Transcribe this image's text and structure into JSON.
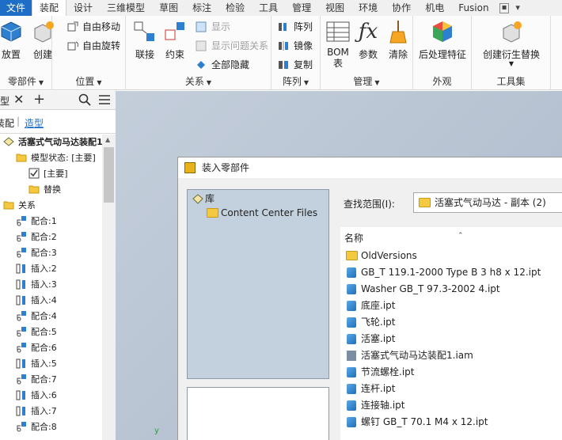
{
  "tabs": [
    {
      "label": "文件",
      "kind": "file"
    },
    {
      "label": "装配",
      "kind": "active"
    },
    {
      "label": "设计"
    },
    {
      "label": "三维模型"
    },
    {
      "label": "草图"
    },
    {
      "label": "标注"
    },
    {
      "label": "检验"
    },
    {
      "label": "工具"
    },
    {
      "label": "管理"
    },
    {
      "label": "视图"
    },
    {
      "label": "环境"
    },
    {
      "label": "协作"
    },
    {
      "label": "机电"
    },
    {
      "label": "Fusion"
    }
  ],
  "ribbon": {
    "components": {
      "label": "零部件",
      "place": "放置",
      "create": "创建"
    },
    "position": {
      "label": "位置",
      "free_move": "自由移动",
      "free_rotate": "自由旋转"
    },
    "relations": {
      "label": "关系",
      "joint": "联接",
      "constrain": "约束",
      "show": "显示",
      "show_sick": "显示问题关系",
      "hide_all": "全部隐藏"
    },
    "pattern": {
      "label": "阵列",
      "pattern": "阵列",
      "mirror": "镜像",
      "copy": "复制"
    },
    "manage": {
      "label": "管理",
      "bom_line1": "BOM",
      "bom_line2": "表",
      "params": "参数",
      "clean": "清除"
    },
    "appearance": {
      "label": "外观",
      "post_process": "后处理特征"
    },
    "productivity": {
      "label": "工具集",
      "derived_replace": "创建衍生替换"
    }
  },
  "browser": {
    "header_tab": "型",
    "tab_assembly": "装配",
    "tab_modeling": "造型",
    "rows": [
      {
        "label": "活塞式气动马达装配1.",
        "indent": 4,
        "bold": true,
        "icon": "assembly-icon"
      },
      {
        "label": "模型状态: [主要]",
        "indent": 20,
        "icon": "folder-icon"
      },
      {
        "label": "[主要]",
        "indent": 36,
        "icon": "model-state-icon"
      },
      {
        "label": "替换",
        "indent": 36,
        "icon": "folder-icon"
      },
      {
        "label": "关系",
        "indent": 4,
        "icon": "folder-icon"
      },
      {
        "label": "配合:1",
        "indent": 20,
        "icon": "mate-icon"
      },
      {
        "label": "配合:2",
        "indent": 20,
        "icon": "mate-icon"
      },
      {
        "label": "配合:3",
        "indent": 20,
        "icon": "mate-icon"
      },
      {
        "label": "插入:2",
        "indent": 20,
        "icon": "insert-icon"
      },
      {
        "label": "插入:3",
        "indent": 20,
        "icon": "insert-icon"
      },
      {
        "label": "插入:4",
        "indent": 20,
        "icon": "insert-icon"
      },
      {
        "label": "配合:4",
        "indent": 20,
        "icon": "mate-icon"
      },
      {
        "label": "配合:5",
        "indent": 20,
        "icon": "mate-icon"
      },
      {
        "label": "配合:6",
        "indent": 20,
        "icon": "mate-icon"
      },
      {
        "label": "插入:5",
        "indent": 20,
        "icon": "insert-icon"
      },
      {
        "label": "配合:7",
        "indent": 20,
        "icon": "mate-icon"
      },
      {
        "label": "插入:6",
        "indent": 20,
        "icon": "insert-icon"
      },
      {
        "label": "插入:7",
        "indent": 20,
        "icon": "insert-icon"
      },
      {
        "label": "配合:8",
        "indent": 20,
        "icon": "mate-icon"
      }
    ]
  },
  "dialog": {
    "title": "装入零部件",
    "library_root": "库",
    "library_child": "Content Center Files",
    "look_in_label": "查找范围(I):",
    "look_in_value": "活塞式气动马达 - 副本 (2)",
    "column_name": "名称",
    "files": [
      {
        "name": "OldVersions",
        "type": "folder"
      },
      {
        "name": "GB_T 119.1-2000 Type B 3 h8 x 12.ipt",
        "type": "part"
      },
      {
        "name": "Washer GB_T 97.3-2002 4.ipt",
        "type": "part"
      },
      {
        "name": "底座.ipt",
        "type": "part"
      },
      {
        "name": "飞轮.ipt",
        "type": "part"
      },
      {
        "name": "活塞.ipt",
        "type": "part"
      },
      {
        "name": "活塞式气动马达装配1.iam",
        "type": "assembly"
      },
      {
        "name": "节流螺栓.ipt",
        "type": "part"
      },
      {
        "name": "连杆.ipt",
        "type": "part"
      },
      {
        "name": "连接轴.ipt",
        "type": "part"
      },
      {
        "name": "螺钉 GB_T 70.1 M4 x 12.ipt",
        "type": "part"
      }
    ]
  },
  "colors": {
    "file_tab": "#1e6ec8",
    "library_bg": "#c3d1df",
    "link_blue": "#1e6ec8",
    "viewport": "#b6c2d1"
  }
}
